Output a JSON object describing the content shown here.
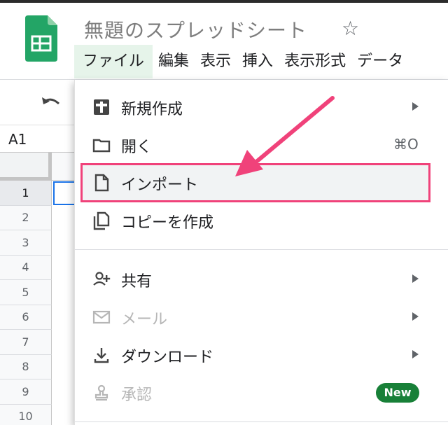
{
  "document": {
    "title": "無題のスプレッドシート",
    "star_glyph": "☆"
  },
  "menubar": [
    "ファイル",
    "編集",
    "表示",
    "挿入",
    "表示形式",
    "データ"
  ],
  "formula_bar": {
    "cell_reference": "A1"
  },
  "row_numbers": [
    "1",
    "2",
    "3",
    "4",
    "5",
    "6",
    "7",
    "8",
    "9",
    "10"
  ],
  "file_menu": {
    "new": {
      "label": "新規作成",
      "icon": "new-document-plus-icon"
    },
    "open": {
      "label": "開く",
      "shortcut": "⌘O",
      "icon": "folder-icon"
    },
    "import": {
      "label": "インポート",
      "icon": "file-icon"
    },
    "copy": {
      "label": "コピーを作成",
      "icon": "copy-icon"
    },
    "share": {
      "label": "共有",
      "icon": "person-add-icon"
    },
    "email": {
      "label": "メール",
      "icon": "envelope-icon",
      "disabled": true
    },
    "download": {
      "label": "ダウンロード",
      "icon": "download-icon"
    },
    "approval": {
      "label": "承認",
      "icon": "stamp-icon",
      "disabled": true,
      "badge": "New"
    }
  },
  "colors": {
    "highlight_border": "#f0427a",
    "arrow": "#f0427a",
    "badge_bg": "#188038",
    "logo_green": "#23a566",
    "menubar_active_bg": "#e6f4ea",
    "selection_blue": "#1a73e8"
  }
}
